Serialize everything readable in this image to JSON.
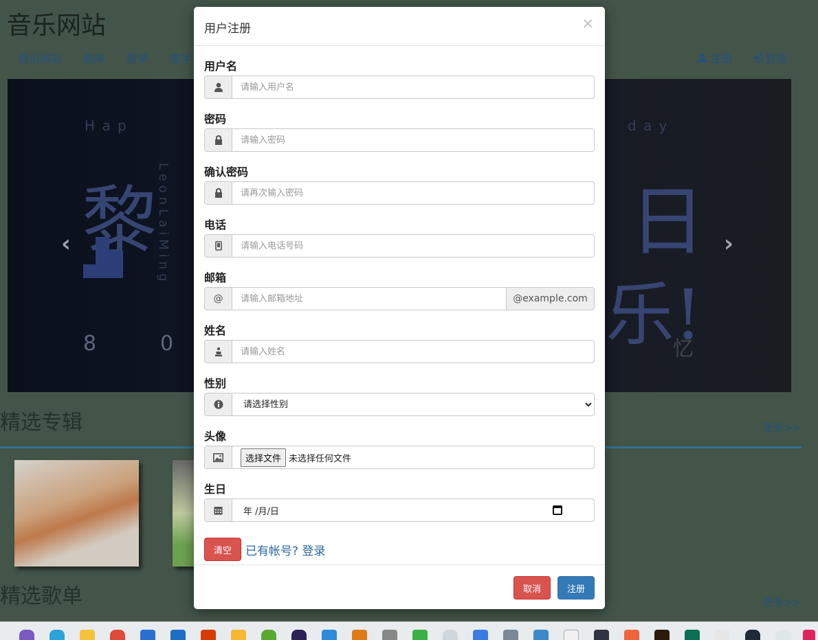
{
  "site": {
    "title": "音乐网站",
    "nav": [
      "音乐网站",
      "曲库",
      "歌单",
      "歌手"
    ],
    "nav_right": {
      "register": "注册",
      "login": "登录"
    }
  },
  "carousel": {
    "chars_left": "黎",
    "chars_right_top": "日",
    "chars_right_bottom": "乐!",
    "text_hap": "H a p",
    "text_day": "d a y",
    "text_leon": "LeonLaiMing",
    "digit_8": "8",
    "digit_0": "0",
    "char_yi": "忆",
    "prev_arrow": "‹",
    "next_arrow": "›"
  },
  "sections": {
    "albums_title": "精选专辑",
    "playlists_title": "精选歌单",
    "more": "更多>>"
  },
  "modal": {
    "title": "用户注册",
    "close": "×",
    "fields": {
      "username": {
        "label": "用户名",
        "placeholder": "请输入用户名"
      },
      "password": {
        "label": "密码",
        "placeholder": "请输入密码"
      },
      "confirm": {
        "label": "确认密码",
        "placeholder": "请再次输入密码"
      },
      "phone": {
        "label": "电话",
        "placeholder": "请输入电话号码"
      },
      "email": {
        "label": "邮箱",
        "addon": "@",
        "placeholder": "请输入邮箱地址",
        "suffix": "@example.com"
      },
      "name": {
        "label": "姓名",
        "placeholder": "请输入姓名"
      },
      "gender": {
        "label": "性别",
        "selected": "请选择性别"
      },
      "avatar": {
        "label": "头像",
        "button": "选择文件",
        "status": "未选择任何文件"
      },
      "birthday": {
        "label": "生日",
        "value": "年 /月/日"
      }
    },
    "clear_button": "清空",
    "login_link": "已有帐号? 登录",
    "cancel_button": "取消",
    "register_button": "注册"
  },
  "colors": {
    "background": "#4d6154",
    "primary": "#337ab7",
    "danger": "#d9534f",
    "link": "#2a6aa0"
  }
}
